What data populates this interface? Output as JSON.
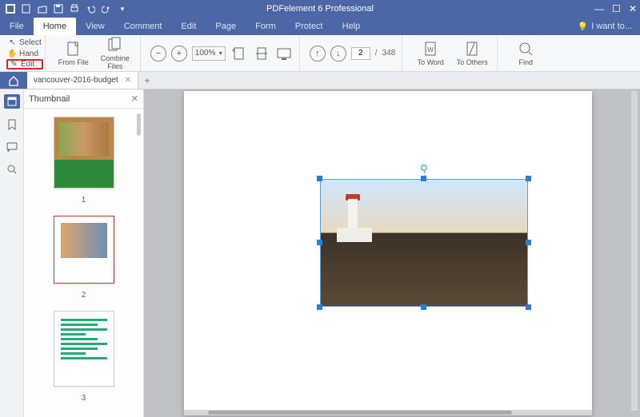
{
  "app": {
    "title": "PDFelement 6 Professional"
  },
  "menu": {
    "items": [
      "File",
      "Home",
      "View",
      "Comment",
      "Edit",
      "Page",
      "Form",
      "Protect",
      "Help"
    ],
    "active": "Home",
    "iwantto": "I want to..."
  },
  "ribbon": {
    "select": "Select",
    "hand": "Hand",
    "edit": "Edit",
    "from_file": "From File",
    "combine": "Combine\nFiles",
    "zoom": "100%",
    "page_current": "2",
    "page_sep": "/",
    "page_total": "348",
    "to_word": "To Word",
    "to_others": "To Others",
    "find": "Find"
  },
  "tabs": {
    "doc": "vancouver-2016-budget"
  },
  "panel": {
    "title": "Thumbnail"
  },
  "thumbs": {
    "n1": "1",
    "n2": "2",
    "n3": "3"
  }
}
